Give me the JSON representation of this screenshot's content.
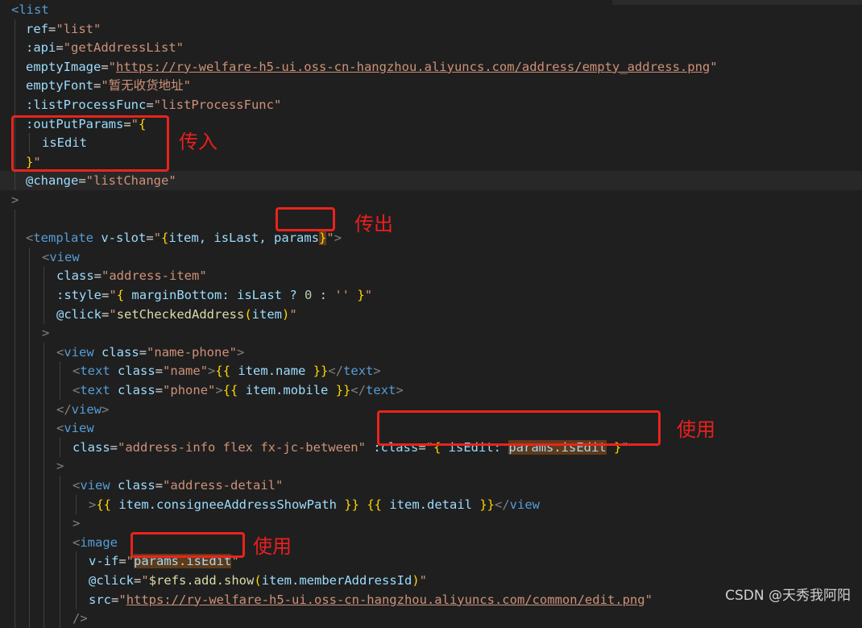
{
  "lines": [
    {
      "k": "list_open",
      "parts": [
        [
          "<",
          "t"
        ],
        [
          "list",
          "t"
        ]
      ]
    },
    {
      "k": "ref",
      "parts": [
        [
          "ref",
          "a"
        ],
        [
          "=",
          "w"
        ],
        [
          "\"list\"",
          "s"
        ]
      ]
    },
    {
      "k": "api",
      "parts": [
        [
          ":api",
          "a"
        ],
        [
          "=",
          "w"
        ],
        [
          "\"getAddressList\"",
          "s"
        ]
      ]
    },
    {
      "k": "emptyImage",
      "parts": [
        [
          "emptyImage",
          "a"
        ],
        [
          "=",
          "w"
        ],
        [
          "\"",
          "s"
        ],
        [
          "https://ry-welfare-h5-ui.oss-cn-hangzhou.aliyuncs.com/address/empty_address.png",
          "u"
        ],
        [
          "\"",
          "s"
        ]
      ]
    },
    {
      "k": "emptyFont",
      "parts": [
        [
          "emptyFont",
          "a"
        ],
        [
          "=",
          "w"
        ],
        [
          "\"暂无收货地址\"",
          "s"
        ]
      ]
    },
    {
      "k": "listProcessFunc",
      "parts": [
        [
          ":listProcessFunc",
          "a"
        ],
        [
          "=",
          "w"
        ],
        [
          "\"listProcessFunc\"",
          "s"
        ]
      ]
    },
    {
      "k": "outPutParams",
      "parts": [
        [
          ":outPutParams",
          "a"
        ],
        [
          "=",
          "w"
        ],
        [
          "\"",
          "s"
        ],
        [
          "{",
          "y"
        ]
      ]
    },
    {
      "k": "isEdit",
      "parts": [
        [
          "isEdit",
          "v"
        ]
      ]
    },
    {
      "k": "outPutParams_close",
      "parts": [
        [
          "}",
          "y"
        ],
        [
          "\"",
          "s"
        ]
      ]
    },
    {
      "k": "change",
      "parts": [
        [
          "@change",
          "a"
        ],
        [
          "=",
          "w"
        ],
        [
          "\"listChange\"",
          "s"
        ]
      ]
    },
    {
      "k": "gt",
      "parts": [
        [
          ">",
          "p"
        ]
      ]
    },
    {
      "k": "blank",
      "parts": []
    },
    {
      "k": "template",
      "parts": [
        [
          "<",
          "p"
        ],
        [
          "template",
          "t"
        ],
        [
          " ",
          "w"
        ],
        [
          "v-slot",
          "a"
        ],
        [
          "=",
          "w"
        ],
        [
          "\"",
          "s"
        ],
        [
          "{",
          "y"
        ],
        [
          "item, isLast, ",
          "v"
        ],
        [
          "params",
          "v"
        ],
        [
          "}",
          "y"
        ],
        [
          "\"",
          "s"
        ],
        [
          ">",
          "p"
        ]
      ]
    },
    {
      "k": "view_open",
      "parts": [
        [
          "<",
          "p"
        ],
        [
          "view",
          "t"
        ]
      ]
    },
    {
      "k": "class_item",
      "parts": [
        [
          "class",
          "a"
        ],
        [
          "=",
          "w"
        ],
        [
          "\"address-item\"",
          "s"
        ]
      ]
    },
    {
      "k": "style",
      "parts": [
        [
          ":style",
          "a"
        ],
        [
          "=",
          "w"
        ],
        [
          "\"",
          "s"
        ],
        [
          "{",
          "y"
        ],
        [
          " marginBottom: isLast ? ",
          "v"
        ],
        [
          "0",
          "n"
        ],
        [
          " : ",
          "w"
        ],
        [
          "''",
          "s"
        ],
        [
          " ",
          "w"
        ],
        [
          "}",
          "y"
        ],
        [
          "\"",
          "s"
        ]
      ]
    },
    {
      "k": "click_set",
      "parts": [
        [
          "@click",
          "a"
        ],
        [
          "=",
          "w"
        ],
        [
          "\"",
          "s"
        ],
        [
          "setCheckedAddress",
          "f"
        ],
        [
          "(",
          "y"
        ],
        [
          "item",
          "v"
        ],
        [
          ")",
          "y"
        ],
        [
          "\"",
          "s"
        ]
      ]
    },
    {
      "k": "gt2",
      "parts": [
        [
          ">",
          "p"
        ]
      ]
    },
    {
      "k": "view_name_phone",
      "parts": [
        [
          "<",
          "p"
        ],
        [
          "view",
          "t"
        ],
        [
          " ",
          "w"
        ],
        [
          "class",
          "a"
        ],
        [
          "=",
          "w"
        ],
        [
          "\"name-phone\"",
          "s"
        ],
        [
          ">",
          "p"
        ]
      ]
    },
    {
      "k": "text_name",
      "parts": [
        [
          "<",
          "p"
        ],
        [
          "text",
          "t"
        ],
        [
          " ",
          "w"
        ],
        [
          "class",
          "a"
        ],
        [
          "=",
          "w"
        ],
        [
          "\"name\"",
          "s"
        ],
        [
          ">",
          "p"
        ],
        [
          "{{",
          "y"
        ],
        [
          " item.name ",
          "v"
        ],
        [
          "}}",
          "y"
        ],
        [
          "</",
          "p"
        ],
        [
          "text",
          "t"
        ],
        [
          ">",
          "p"
        ]
      ]
    },
    {
      "k": "text_phone",
      "parts": [
        [
          "<",
          "p"
        ],
        [
          "text",
          "t"
        ],
        [
          " ",
          "w"
        ],
        [
          "class",
          "a"
        ],
        [
          "=",
          "w"
        ],
        [
          "\"phone\"",
          "s"
        ],
        [
          ">",
          "p"
        ],
        [
          "{{",
          "y"
        ],
        [
          " item.mobile ",
          "v"
        ],
        [
          "}}",
          "y"
        ],
        [
          "</",
          "p"
        ],
        [
          "text",
          "t"
        ],
        [
          ">",
          "p"
        ]
      ]
    },
    {
      "k": "view_close",
      "parts": [
        [
          "</",
          "p"
        ],
        [
          "view",
          "t"
        ],
        [
          ">",
          "p"
        ]
      ]
    },
    {
      "k": "view_open2",
      "parts": [
        [
          "<",
          "p"
        ],
        [
          "view",
          "t"
        ]
      ]
    },
    {
      "k": "class_info",
      "parts": [
        [
          "class",
          "a"
        ],
        [
          "=",
          "w"
        ],
        [
          "\"address-info flex fx-jc-between\"",
          "s"
        ],
        [
          " ",
          "w"
        ],
        [
          ":class",
          "a"
        ],
        [
          "=",
          "w"
        ],
        [
          "\"",
          "s"
        ],
        [
          "{",
          "y"
        ],
        [
          " isEdit: ",
          "v"
        ],
        [
          "params.isEdit",
          "v"
        ],
        [
          " ",
          "w"
        ],
        [
          "}",
          "y"
        ],
        [
          "\"",
          "s"
        ]
      ]
    },
    {
      "k": "gt3",
      "parts": [
        [
          ">",
          "p"
        ]
      ]
    },
    {
      "k": "view_detail",
      "parts": [
        [
          "<",
          "p"
        ],
        [
          "view",
          "t"
        ],
        [
          " ",
          "w"
        ],
        [
          "class",
          "a"
        ],
        [
          "=",
          "w"
        ],
        [
          "\"address-detail\"",
          "s"
        ]
      ]
    },
    {
      "k": "detail_text",
      "parts": [
        [
          ">",
          "p"
        ],
        [
          "{{",
          "y"
        ],
        [
          " item.consigneeAddressShowPath ",
          "v"
        ],
        [
          "}}",
          "y"
        ],
        [
          " ",
          "w"
        ],
        [
          "{{",
          "y"
        ],
        [
          " item.detail ",
          "v"
        ],
        [
          "}}",
          "y"
        ],
        [
          "</",
          "p"
        ],
        [
          "view",
          "t"
        ]
      ]
    },
    {
      "k": "gt4",
      "parts": [
        [
          ">",
          "p"
        ]
      ]
    },
    {
      "k": "image_open",
      "parts": [
        [
          "<",
          "p"
        ],
        [
          "image",
          "t"
        ]
      ]
    },
    {
      "k": "vif",
      "parts": [
        [
          "v-if",
          "a"
        ],
        [
          "=",
          "w"
        ],
        [
          "\"",
          "s"
        ],
        [
          "params.isEdit",
          "v"
        ],
        [
          "\"",
          "s"
        ]
      ]
    },
    {
      "k": "click_add",
      "parts": [
        [
          "@click",
          "a"
        ],
        [
          "=",
          "w"
        ],
        [
          "\"",
          "s"
        ],
        [
          "$refs.add.show",
          "f"
        ],
        [
          "(",
          "y"
        ],
        [
          "item.memberAddressId",
          "v"
        ],
        [
          ")",
          "y"
        ],
        [
          "\"",
          "s"
        ]
      ]
    },
    {
      "k": "src",
      "parts": [
        [
          "src",
          "a"
        ],
        [
          "=",
          "w"
        ],
        [
          "\"",
          "s"
        ],
        [
          "https://ry-welfare-h5-ui.oss-cn-hangzhou.aliyuncs.com/common/edit.png",
          "u"
        ],
        [
          "\"",
          "s"
        ]
      ]
    },
    {
      "k": "selfclose",
      "parts": [
        [
          "/>",
          "p"
        ]
      ]
    }
  ],
  "annotations": {
    "pass_in": "传入",
    "pass_out": "传出",
    "use_1": "使用",
    "use_2": "使用"
  },
  "watermark": "CSDN @天秀我阿阳",
  "colors": {
    "annotation": "#e8241d",
    "background": "#1f1f1f",
    "highlight": "#613a18"
  }
}
